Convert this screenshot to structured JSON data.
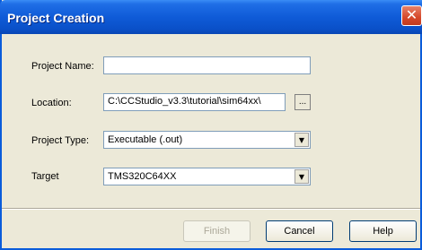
{
  "window": {
    "title": "Project Creation",
    "close_symbol": "✕"
  },
  "form": {
    "project_name": {
      "label": "Project Name:",
      "value": "",
      "placeholder": ""
    },
    "location": {
      "label": "Location:",
      "value": "C:\\CCStudio_v3.3\\tutorial\\sim64xx\\",
      "browse_label": "..."
    },
    "project_type": {
      "label": "Project Type:",
      "value": "Executable (.out)"
    },
    "target": {
      "label": "Target",
      "value": "TMS320C64XX"
    }
  },
  "buttons": {
    "finish": "Finish",
    "cancel": "Cancel",
    "help": "Help"
  },
  "colors": {
    "titlebar": "#0a50c8",
    "dialog_bg": "#ece9d8",
    "close_button": "#d6482a"
  },
  "icons": {
    "close": "close-icon",
    "dropdown": "chevron-down-icon"
  }
}
